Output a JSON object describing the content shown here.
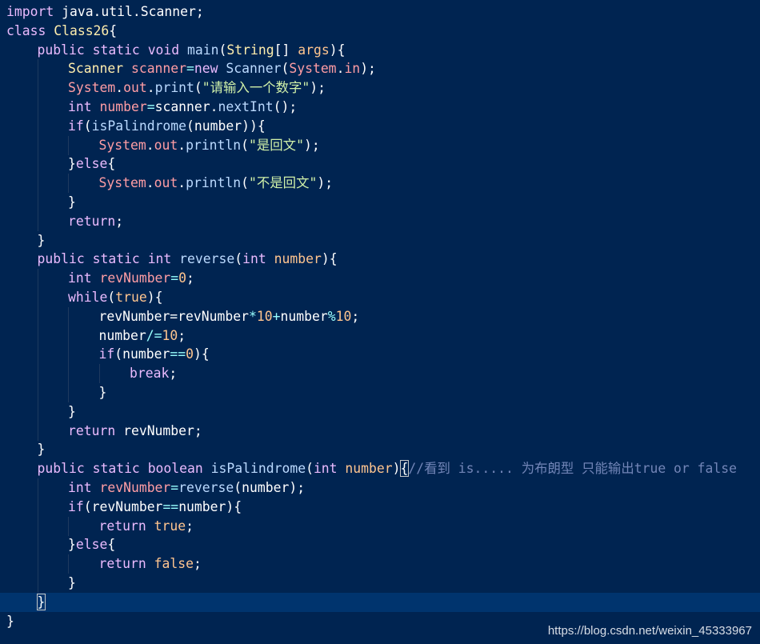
{
  "editor": {
    "theme_colors": {
      "background": "#002451",
      "line_highlight": "#00346e",
      "keyword": "#ebbbff",
      "type": "#ffeead",
      "function": "#bbdaff",
      "string": "#d1f1a9",
      "number": "#ffc58f",
      "variable": "#ff9da4",
      "comment": "#7285b7",
      "operator": "#99ffff",
      "plain": "#ffffff"
    },
    "lines": [
      {
        "indent": 0,
        "tokens": [
          [
            "kw",
            "import"
          ],
          [
            "pl",
            " java.util.Scanner;"
          ]
        ]
      },
      {
        "indent": 0,
        "tokens": [
          [
            "kw",
            "class"
          ],
          [
            "pl",
            " "
          ],
          [
            "ty",
            "Class26"
          ],
          [
            "pl",
            "{"
          ]
        ]
      },
      {
        "indent": 1,
        "tokens": [
          [
            "kw",
            "public"
          ],
          [
            "pl",
            " "
          ],
          [
            "kw",
            "static"
          ],
          [
            "pl",
            " "
          ],
          [
            "kw",
            "void"
          ],
          [
            "pl",
            " "
          ],
          [
            "fn",
            "main"
          ],
          [
            "pl",
            "("
          ],
          [
            "ty",
            "String"
          ],
          [
            "pl",
            "[] "
          ],
          [
            "nu",
            "args"
          ],
          [
            "pl",
            "){"
          ]
        ]
      },
      {
        "indent": 2,
        "tokens": [
          [
            "ty",
            "Scanner"
          ],
          [
            "pl",
            " "
          ],
          [
            "vr",
            "scanner"
          ],
          [
            "op",
            "="
          ],
          [
            "kw",
            "new"
          ],
          [
            "pl",
            " "
          ],
          [
            "fn",
            "Scanner"
          ],
          [
            "pl",
            "("
          ],
          [
            "vr",
            "System"
          ],
          [
            "pl",
            "."
          ],
          [
            "vr",
            "in"
          ],
          [
            "pl",
            ");"
          ]
        ]
      },
      {
        "indent": 2,
        "tokens": [
          [
            "vr",
            "System"
          ],
          [
            "pl",
            "."
          ],
          [
            "vr",
            "out"
          ],
          [
            "pl",
            "."
          ],
          [
            "fn",
            "print"
          ],
          [
            "pl",
            "("
          ],
          [
            "st",
            "\"请输入一个数字\""
          ],
          [
            "pl",
            ");"
          ]
        ]
      },
      {
        "indent": 2,
        "tokens": [
          [
            "kw",
            "int"
          ],
          [
            "pl",
            " "
          ],
          [
            "vr",
            "number"
          ],
          [
            "op",
            "="
          ],
          [
            "pl",
            "scanner."
          ],
          [
            "fn",
            "nextInt"
          ],
          [
            "pl",
            "();"
          ]
        ]
      },
      {
        "indent": 2,
        "tokens": [
          [
            "kw",
            "if"
          ],
          [
            "pl",
            "("
          ],
          [
            "fn",
            "isPalindrome"
          ],
          [
            "pl",
            "(number)){"
          ]
        ]
      },
      {
        "indent": 3,
        "tokens": [
          [
            "vr",
            "System"
          ],
          [
            "pl",
            "."
          ],
          [
            "vr",
            "out"
          ],
          [
            "pl",
            "."
          ],
          [
            "fn",
            "println"
          ],
          [
            "pl",
            "("
          ],
          [
            "st",
            "\"是回文\""
          ],
          [
            "pl",
            ");"
          ]
        ]
      },
      {
        "indent": 2,
        "tokens": [
          [
            "pl",
            "}"
          ],
          [
            "kw",
            "else"
          ],
          [
            "pl",
            "{"
          ]
        ]
      },
      {
        "indent": 3,
        "tokens": [
          [
            "vr",
            "System"
          ],
          [
            "pl",
            "."
          ],
          [
            "vr",
            "out"
          ],
          [
            "pl",
            "."
          ],
          [
            "fn",
            "println"
          ],
          [
            "pl",
            "("
          ],
          [
            "st",
            "\"不是回文\""
          ],
          [
            "pl",
            ");"
          ]
        ]
      },
      {
        "indent": 2,
        "tokens": [
          [
            "pl",
            "}"
          ]
        ]
      },
      {
        "indent": 2,
        "tokens": [
          [
            "kw",
            "return"
          ],
          [
            "pl",
            ";"
          ]
        ]
      },
      {
        "indent": 1,
        "tokens": [
          [
            "pl",
            "}"
          ]
        ]
      },
      {
        "indent": 1,
        "tokens": [
          [
            "kw",
            "public"
          ],
          [
            "pl",
            " "
          ],
          [
            "kw",
            "static"
          ],
          [
            "pl",
            " "
          ],
          [
            "kw",
            "int"
          ],
          [
            "pl",
            " "
          ],
          [
            "fn",
            "reverse"
          ],
          [
            "pl",
            "("
          ],
          [
            "kw",
            "int"
          ],
          [
            "pl",
            " "
          ],
          [
            "nu",
            "number"
          ],
          [
            "pl",
            "){"
          ]
        ]
      },
      {
        "indent": 2,
        "tokens": [
          [
            "kw",
            "int"
          ],
          [
            "pl",
            " "
          ],
          [
            "vr",
            "revNumber"
          ],
          [
            "op",
            "="
          ],
          [
            "nu",
            "0"
          ],
          [
            "pl",
            ";"
          ]
        ]
      },
      {
        "indent": 2,
        "tokens": [
          [
            "kw",
            "while"
          ],
          [
            "pl",
            "("
          ],
          [
            "nu",
            "true"
          ],
          [
            "pl",
            "){"
          ]
        ]
      },
      {
        "indent": 3,
        "tokens": [
          [
            "pl",
            "revNumber=revNumber"
          ],
          [
            "op",
            "*"
          ],
          [
            "nu",
            "10"
          ],
          [
            "op",
            "+"
          ],
          [
            "pl",
            "number"
          ],
          [
            "op",
            "%"
          ],
          [
            "nu",
            "10"
          ],
          [
            "pl",
            ";"
          ]
        ]
      },
      {
        "indent": 3,
        "tokens": [
          [
            "pl",
            "number"
          ],
          [
            "op",
            "/="
          ],
          [
            "nu",
            "10"
          ],
          [
            "pl",
            ";"
          ]
        ]
      },
      {
        "indent": 3,
        "tokens": [
          [
            "kw",
            "if"
          ],
          [
            "pl",
            "(number"
          ],
          [
            "op",
            "=="
          ],
          [
            "nu",
            "0"
          ],
          [
            "pl",
            "){"
          ]
        ]
      },
      {
        "indent": 4,
        "tokens": [
          [
            "kw",
            "break"
          ],
          [
            "pl",
            ";"
          ]
        ]
      },
      {
        "indent": 3,
        "tokens": [
          [
            "pl",
            "}"
          ]
        ]
      },
      {
        "indent": 2,
        "tokens": [
          [
            "pl",
            "}"
          ]
        ]
      },
      {
        "indent": 2,
        "tokens": [
          [
            "kw",
            "return"
          ],
          [
            "pl",
            " revNumber;"
          ]
        ]
      },
      {
        "indent": 1,
        "tokens": [
          [
            "pl",
            "}"
          ]
        ]
      },
      {
        "indent": 1,
        "tokens": [
          [
            "kw",
            "public"
          ],
          [
            "pl",
            " "
          ],
          [
            "kw",
            "static"
          ],
          [
            "pl",
            " "
          ],
          [
            "kw",
            "boolean"
          ],
          [
            "pl",
            " "
          ],
          [
            "fn",
            "isPalindrome"
          ],
          [
            "pl",
            "("
          ],
          [
            "kw",
            "int"
          ],
          [
            "pl",
            " "
          ],
          [
            "nu",
            "number"
          ],
          [
            "pl",
            ")"
          ],
          [
            "bm",
            "{"
          ],
          [
            "cm",
            "//看到 is..... 为布朗型 只能输出true or false"
          ]
        ]
      },
      {
        "indent": 2,
        "tokens": [
          [
            "kw",
            "int"
          ],
          [
            "pl",
            " "
          ],
          [
            "vr",
            "revNumber"
          ],
          [
            "op",
            "="
          ],
          [
            "fn",
            "reverse"
          ],
          [
            "pl",
            "(number);"
          ]
        ]
      },
      {
        "indent": 2,
        "tokens": [
          [
            "kw",
            "if"
          ],
          [
            "pl",
            "(revNumber"
          ],
          [
            "op",
            "=="
          ],
          [
            "pl",
            "number){"
          ]
        ]
      },
      {
        "indent": 3,
        "tokens": [
          [
            "kw",
            "return"
          ],
          [
            "pl",
            " "
          ],
          [
            "nu",
            "true"
          ],
          [
            "pl",
            ";"
          ]
        ]
      },
      {
        "indent": 2,
        "tokens": [
          [
            "pl",
            "}"
          ],
          [
            "kw",
            "else"
          ],
          [
            "pl",
            "{"
          ]
        ]
      },
      {
        "indent": 3,
        "tokens": [
          [
            "kw",
            "return"
          ],
          [
            "pl",
            " "
          ],
          [
            "nu",
            "false"
          ],
          [
            "pl",
            ";"
          ]
        ]
      },
      {
        "indent": 2,
        "tokens": [
          [
            "pl",
            "}"
          ]
        ]
      },
      {
        "indent": 1,
        "highlight": true,
        "tokens": [
          [
            "bm",
            "}"
          ]
        ]
      },
      {
        "indent": 0,
        "tokens": [
          [
            "pl",
            "}"
          ]
        ]
      }
    ]
  },
  "watermark": "https://blog.csdn.net/weixin_45333967"
}
